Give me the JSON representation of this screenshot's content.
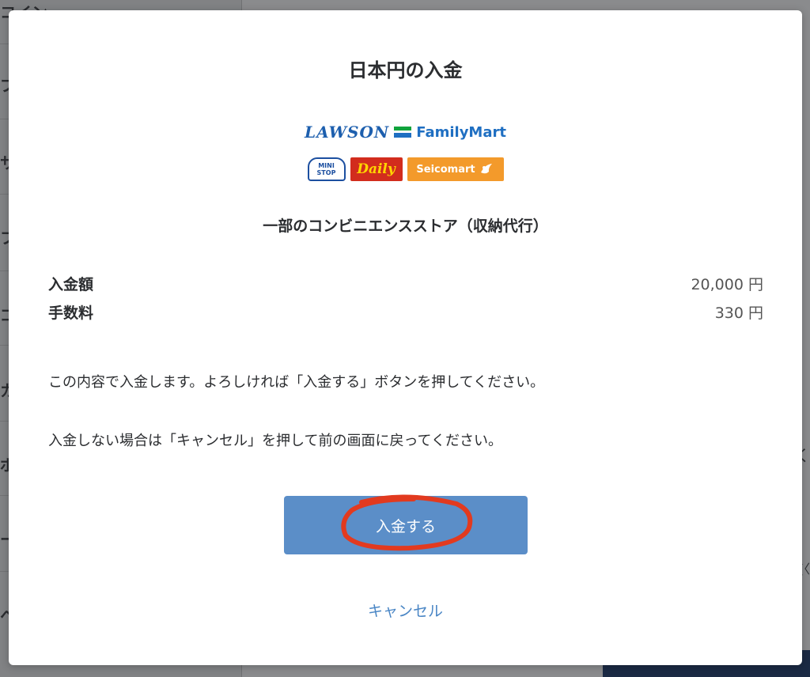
{
  "background": {
    "sidebar_fragments": [
      "コイン",
      "プ",
      "サ",
      "フ",
      "ゴ",
      "カ",
      "ポ",
      "ー",
      "ヘ"
    ],
    "right_fragments": [
      "く",
      "(〈"
    ]
  },
  "modal": {
    "title": "日本円の入金",
    "logos": {
      "lawson": "LAWSON",
      "familymart": "FamilyMart",
      "ministop": "MINI STOP",
      "daily": "Daily",
      "seicomart": "Seicomart"
    },
    "store_description": "一部のコンビニエンスストア（収納代行）",
    "summary": [
      {
        "label": "入金額",
        "value": "20,000 円"
      },
      {
        "label": "手数料",
        "value": "330 円"
      }
    ],
    "message_confirm": "この内容で入金します。よろしければ「入金する」ボタンを押してください。",
    "message_cancel": "入金しない場合は「キャンセル」を押して前の画面に戻ってください。",
    "deposit_button": "入金する",
    "cancel_link": "キャンセル"
  },
  "colors": {
    "primary_button": "#5b8ec8",
    "link": "#4a86c5",
    "annotation_ring": "#e23a1f"
  }
}
